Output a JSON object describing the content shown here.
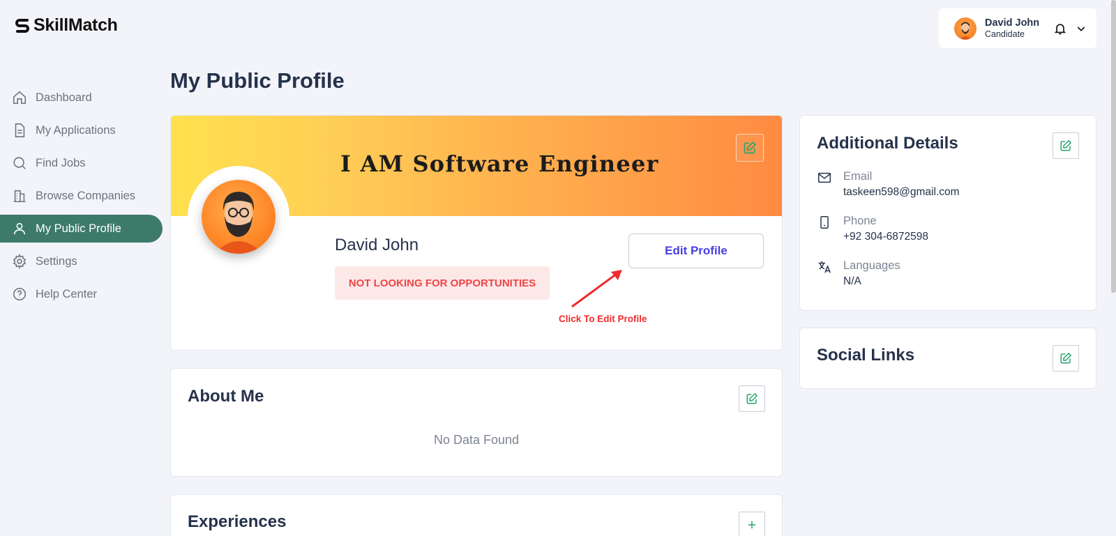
{
  "brand": {
    "name": "SkillMatch"
  },
  "sidebar": {
    "items": [
      {
        "label": "Dashboard",
        "icon": "home-icon",
        "active": false
      },
      {
        "label": "My Applications",
        "icon": "document-icon",
        "active": false
      },
      {
        "label": "Find Jobs",
        "icon": "search-icon",
        "active": false
      },
      {
        "label": "Browse Companies",
        "icon": "building-icon",
        "active": false
      },
      {
        "label": "My Public Profile",
        "icon": "user-icon",
        "active": true
      },
      {
        "label": "Settings",
        "icon": "gear-icon",
        "active": false
      },
      {
        "label": "Help Center",
        "icon": "help-icon",
        "active": false
      }
    ]
  },
  "header": {
    "user_name": "David John",
    "user_role": "Candidate"
  },
  "page": {
    "title": "My Public Profile"
  },
  "profile": {
    "banner_text": "I AM Software Engineer",
    "name": "David John",
    "status": "NOT LOOKING FOR OPPORTUNITIES",
    "edit_label": "Edit Profile",
    "annotation": "Click To  Edit Profile"
  },
  "about": {
    "title": "About Me",
    "empty": "No Data Found"
  },
  "experiences": {
    "title": "Experiences"
  },
  "additional": {
    "title": "Additional Details",
    "email_label": "Email",
    "email": "taskeen598@gmail.com",
    "phone_label": "Phone",
    "phone": "+92 304-6872598",
    "languages_label": "Languages",
    "languages": "N/A"
  },
  "social": {
    "title": "Social Links"
  },
  "colors": {
    "accent": "#3d7a69",
    "primary": "#4640de",
    "status_red": "#ef4444",
    "edit_green": "#26a46f"
  }
}
